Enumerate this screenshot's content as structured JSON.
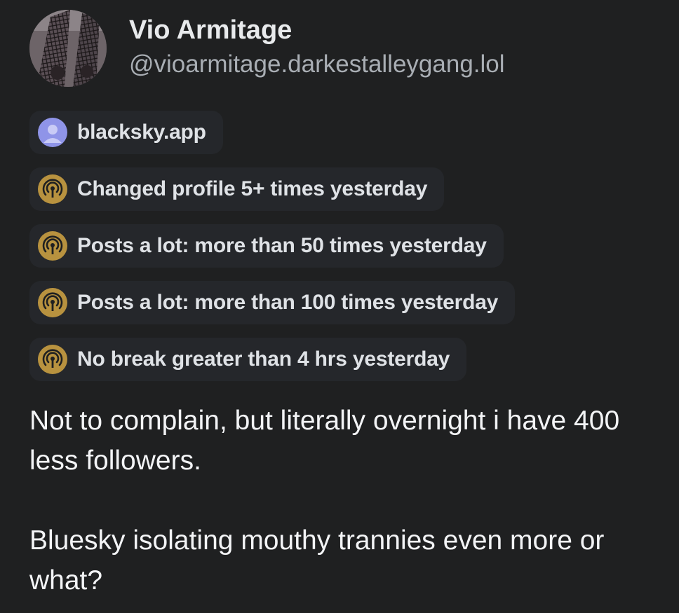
{
  "author": {
    "display_name": "Vio Armitage",
    "handle": "@vioarmitage.darkestalleygang.lol"
  },
  "labels": [
    {
      "text": "blacksky.app",
      "icon": "person-avatar-icon",
      "icon_color": "#8f94e8"
    },
    {
      "text": "Changed profile 5+ times yesterday",
      "icon": "broadcast-icon",
      "icon_color": "#b8923f"
    },
    {
      "text": "Posts a lot: more than 50 times yesterday",
      "icon": "broadcast-icon",
      "icon_color": "#b8923f"
    },
    {
      "text": "Posts a lot: more than 100 times yesterday",
      "icon": "broadcast-icon",
      "icon_color": "#b8923f"
    },
    {
      "text": "No break greater than 4 hrs yesterday",
      "icon": "broadcast-icon",
      "icon_color": "#b8923f"
    }
  ],
  "post": {
    "paragraphs": [
      "Not to complain, but literally overnight i have 400 less followers.",
      "Bluesky isolating mouthy trannies even more or what?"
    ]
  },
  "colors": {
    "background": "#1f2021",
    "pill_background": "#25272b",
    "label_gold": "#b8923f",
    "label_blue": "#8f94e8"
  }
}
